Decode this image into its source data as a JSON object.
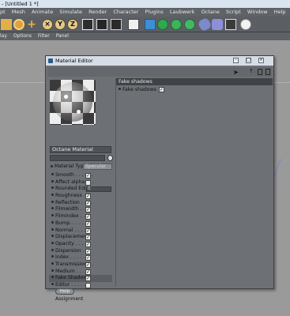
{
  "window": {
    "title": "- [Untitled 1 *]"
  },
  "menubar": [
    "pt",
    "Mesh",
    "Animate",
    "Simulate",
    "Render",
    "Character",
    "Plugins",
    "Laubwerk",
    "Octane",
    "Script",
    "Window",
    "Help"
  ],
  "submenu": [
    "lay",
    "Options",
    "Filter",
    "Panel"
  ],
  "toolbar_icons": [
    "move-icon",
    "rotate-icon",
    "scale-icon",
    "x-axis-icon",
    "y-axis-icon",
    "z-axis-icon",
    "render-region-icon",
    "render-view-icon",
    "render-settings-icon",
    "cube-icon",
    "subdivision-icon",
    "spline-icon",
    "sphere-icon",
    "deformer-icon",
    "scene-icon",
    "camera-icon",
    "light-icon"
  ],
  "material_editor": {
    "title": "Material Editor",
    "material_name": "Octane Material",
    "material_type_label": "Material Type",
    "material_type_value": "Specular",
    "channels": [
      {
        "label": "Smooth . . . . . .",
        "checked": true
      },
      {
        "label": "Affect alpha . . .",
        "checked": false
      },
      {
        "label": "Rounded Edges",
        "value": "0"
      },
      {
        "label": "Roughness . . .",
        "checked": true
      },
      {
        "label": "Reflection . . . .",
        "checked": true
      },
      {
        "label": "Filmwidth . . . .",
        "checked": true
      },
      {
        "label": "FilmIndex . . . .",
        "checked": true
      },
      {
        "label": "Bump. . . . . . .",
        "checked": true
      },
      {
        "label": "Normal . . . . . .",
        "checked": true
      },
      {
        "label": "Displacement",
        "checked": true
      },
      {
        "label": "Opacity . . . . .",
        "checked": true
      },
      {
        "label": "Dispersion . . .",
        "checked": true
      },
      {
        "label": "Index . . . . . . .",
        "checked": true
      },
      {
        "label": "Transmission . .",
        "checked": true
      },
      {
        "label": "Medium . . . . .",
        "checked": true
      },
      {
        "label": "Fake Shadows",
        "checked": true,
        "selected": true
      },
      {
        "label": "Editor . . . . . .",
        "checked": false
      }
    ],
    "help_label": "Help",
    "assignment_label": "Assignment",
    "section_title": "Fake shadows",
    "section_field_label": "Fake shadows",
    "section_field_checked": true
  }
}
